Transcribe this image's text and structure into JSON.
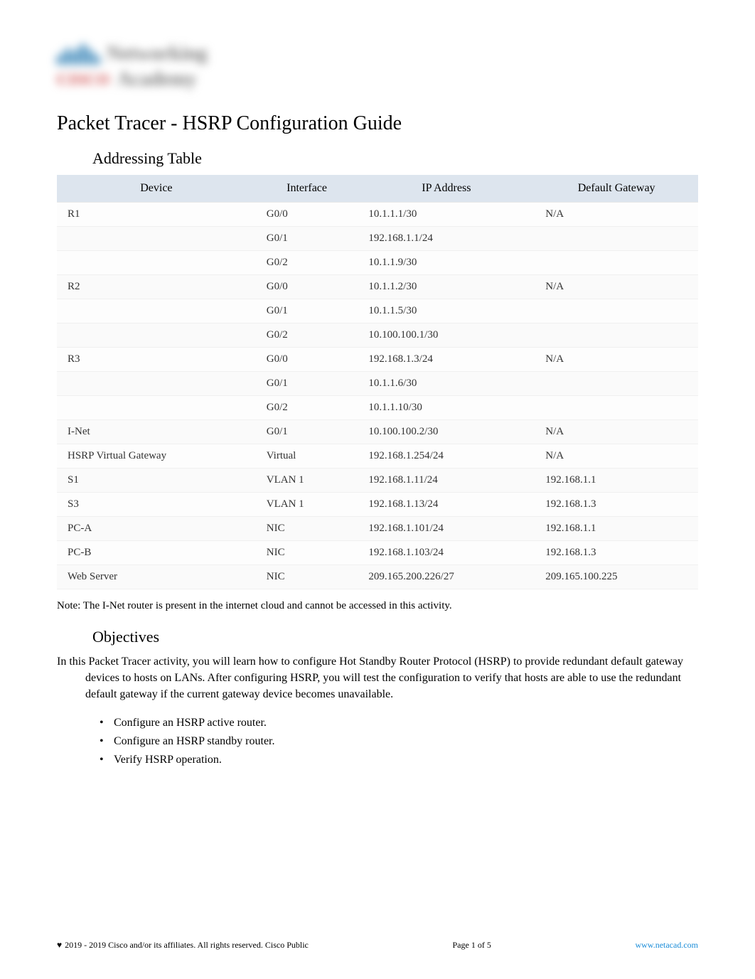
{
  "logo": {
    "line1": "Networking",
    "line2_brand": "CISCO",
    "line2": "Academy"
  },
  "title": "Packet Tracer - HSRP Configuration Guide",
  "sections": {
    "addressing_heading": "Addressing Table",
    "objectives_heading": "Objectives"
  },
  "table": {
    "headers": {
      "device": "Device",
      "interface": "Interface",
      "ip": "IP Address",
      "gateway": "Default Gateway"
    },
    "rows": [
      {
        "device": "R1",
        "interface": "G0/0",
        "ip": "10.1.1.1/30",
        "gateway": "N/A"
      },
      {
        "device": "",
        "interface": "G0/1",
        "ip": "192.168.1.1/24",
        "gateway": ""
      },
      {
        "device": "",
        "interface": "G0/2",
        "ip": "10.1.1.9/30",
        "gateway": ""
      },
      {
        "device": "R2",
        "interface": "G0/0",
        "ip": "10.1.1.2/30",
        "gateway": "N/A"
      },
      {
        "device": "",
        "interface": "G0/1",
        "ip": "10.1.1.5/30",
        "gateway": ""
      },
      {
        "device": "",
        "interface": "G0/2",
        "ip": "10.100.100.1/30",
        "gateway": ""
      },
      {
        "device": "R3",
        "interface": "G0/0",
        "ip": "192.168.1.3/24",
        "gateway": "N/A"
      },
      {
        "device": "",
        "interface": "G0/1",
        "ip": "10.1.1.6/30",
        "gateway": ""
      },
      {
        "device": "",
        "interface": "G0/2",
        "ip": "10.1.1.10/30",
        "gateway": ""
      },
      {
        "device": "I-Net",
        "interface": "G0/1",
        "ip": "10.100.100.2/30",
        "gateway": "N/A"
      },
      {
        "device": "HSRP Virtual Gateway",
        "interface": "Virtual",
        "ip": "192.168.1.254/24",
        "gateway": "N/A"
      },
      {
        "device": "S1",
        "interface": "VLAN 1",
        "ip": "192.168.1.11/24",
        "gateway": "192.168.1.1"
      },
      {
        "device": "S3",
        "interface": "VLAN 1",
        "ip": "192.168.1.13/24",
        "gateway": "192.168.1.3"
      },
      {
        "device": "PC-A",
        "interface": "NIC",
        "ip": "192.168.1.101/24",
        "gateway": "192.168.1.1"
      },
      {
        "device": "PC-B",
        "interface": "NIC",
        "ip": "192.168.1.103/24",
        "gateway": "192.168.1.3"
      },
      {
        "device": "Web Server",
        "interface": "NIC",
        "ip": "209.165.200.226/27",
        "gateway": "209.165.100.225"
      }
    ]
  },
  "note_text": "Note:  The I-Net router is present in the internet cloud and cannot be accessed in this activity.",
  "objectives_intro": "In this Packet Tracer activity, you will learn how to configure Hot Standby Router Protocol (HSRP) to provide redundant default gateway devices to hosts on LANs. After configuring HSRP, you will test the configuration to verify that hosts are able to use the redundant default gateway if the current gateway device becomes unavailable.",
  "objectives_list": [
    "Configure an HSRP active router.",
    "Configure an HSRP standby router.",
    "Verify HSRP operation."
  ],
  "footer": {
    "copyright": "2019 - 2019 Cisco and/or its affiliates. All rights reserved. Cisco Public",
    "page": "Page 1 of 5",
    "link": "www.netacad.com"
  }
}
